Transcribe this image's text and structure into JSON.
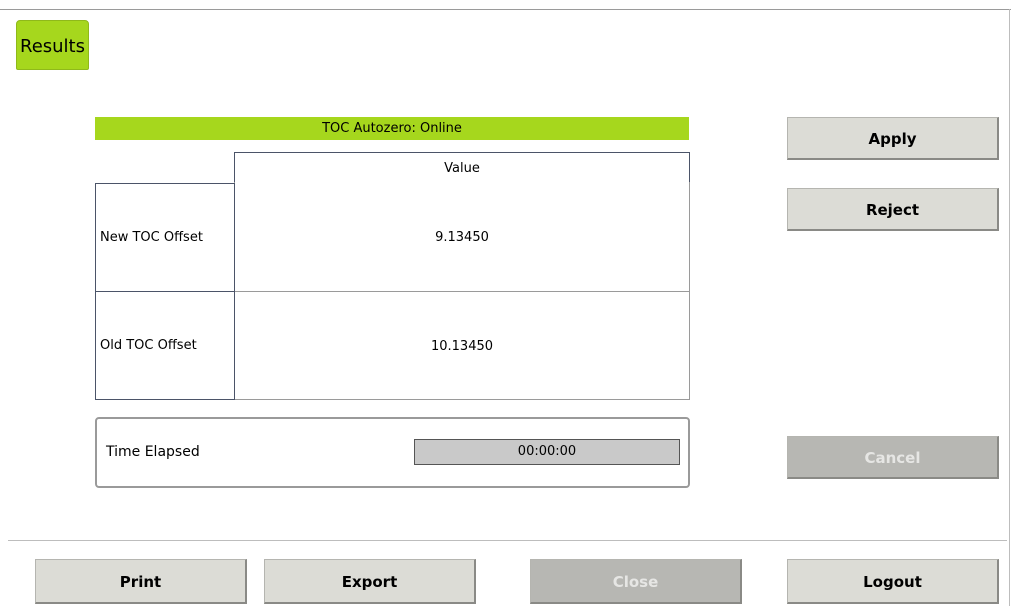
{
  "tabs": {
    "results_label": "Results"
  },
  "status": {
    "title": "TOC Autozero: Online"
  },
  "table": {
    "value_header": "Value",
    "rows": [
      {
        "label": "New TOC Offset",
        "value": "9.13450"
      },
      {
        "label": "Old TOC Offset",
        "value": "10.13450"
      }
    ]
  },
  "timer": {
    "label": "Time Elapsed",
    "value": "00:00:00"
  },
  "actions": {
    "apply_label": "Apply",
    "reject_label": "Reject",
    "cancel_label": "Cancel",
    "cancel_enabled": false
  },
  "footer": {
    "print_label": "Print",
    "export_label": "Export",
    "close_label": "Close",
    "close_enabled": false,
    "logout_label": "Logout"
  },
  "colors": {
    "accent": "#a6d71d",
    "button": "#dcdcd6",
    "button_disabled": "#b7b7b3",
    "field": "#c9c9c9"
  }
}
